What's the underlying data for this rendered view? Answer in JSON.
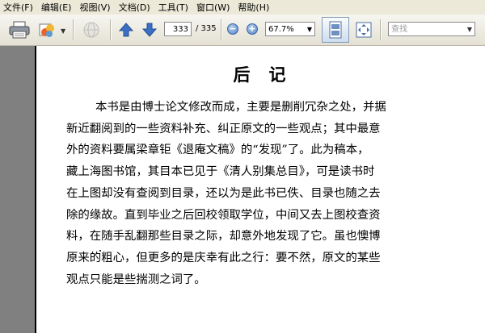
{
  "menu": [
    {
      "label": "文件(F)"
    },
    {
      "label": "编辑(E)"
    },
    {
      "label": "视图(V)"
    },
    {
      "label": "文档(D)"
    },
    {
      "label": "工具(T)"
    },
    {
      "label": "窗口(W)"
    },
    {
      "label": "帮助(H)"
    }
  ],
  "toolbar": {
    "page_current": "333",
    "page_total": "/ 335",
    "zoom": "67.7%",
    "search_placeholder": "查找"
  },
  "icons": {
    "print": "printer-icon",
    "publish": "layers-icon",
    "globe": "globe-icon",
    "prev": "arrow-up-icon",
    "next": "arrow-down-icon",
    "zoom_out": "zoom-out-icon",
    "zoom_in": "zoom-in-icon",
    "fit_page": "fit-page-icon",
    "fit_width": "fit-width-icon"
  },
  "document": {
    "title": "后　记",
    "lines": [
      "本书是由博士论文修改而成，主要是删削冗杂之处，并据",
      "新近翻阅到的一些资料补充、纠正原文的一些观点；其中最意",
      "外的资料要属梁章钜《退庵文稿》的“发现”了。此为稿本，",
      "藏上海图书馆，其目本已见于《清人别集总目》，可是读书时",
      "在上图却没有查阅到目录，还以为是此书已佚、目录也随之去",
      "除的缘故。直到毕业之后回校领取学位，中间又去上图校查资",
      "料，在随手乱翻那些目录之际，却意外地发现了它。虽也懊博",
      "原来的粗心，但更多的是庆幸有此之行：要不然，原文的某些",
      "观点只能是些揣测之词了。"
    ]
  },
  "colors": {
    "chrome": "#ece9d8",
    "side_panel": "#808080",
    "accent": "#3a6fc4"
  }
}
